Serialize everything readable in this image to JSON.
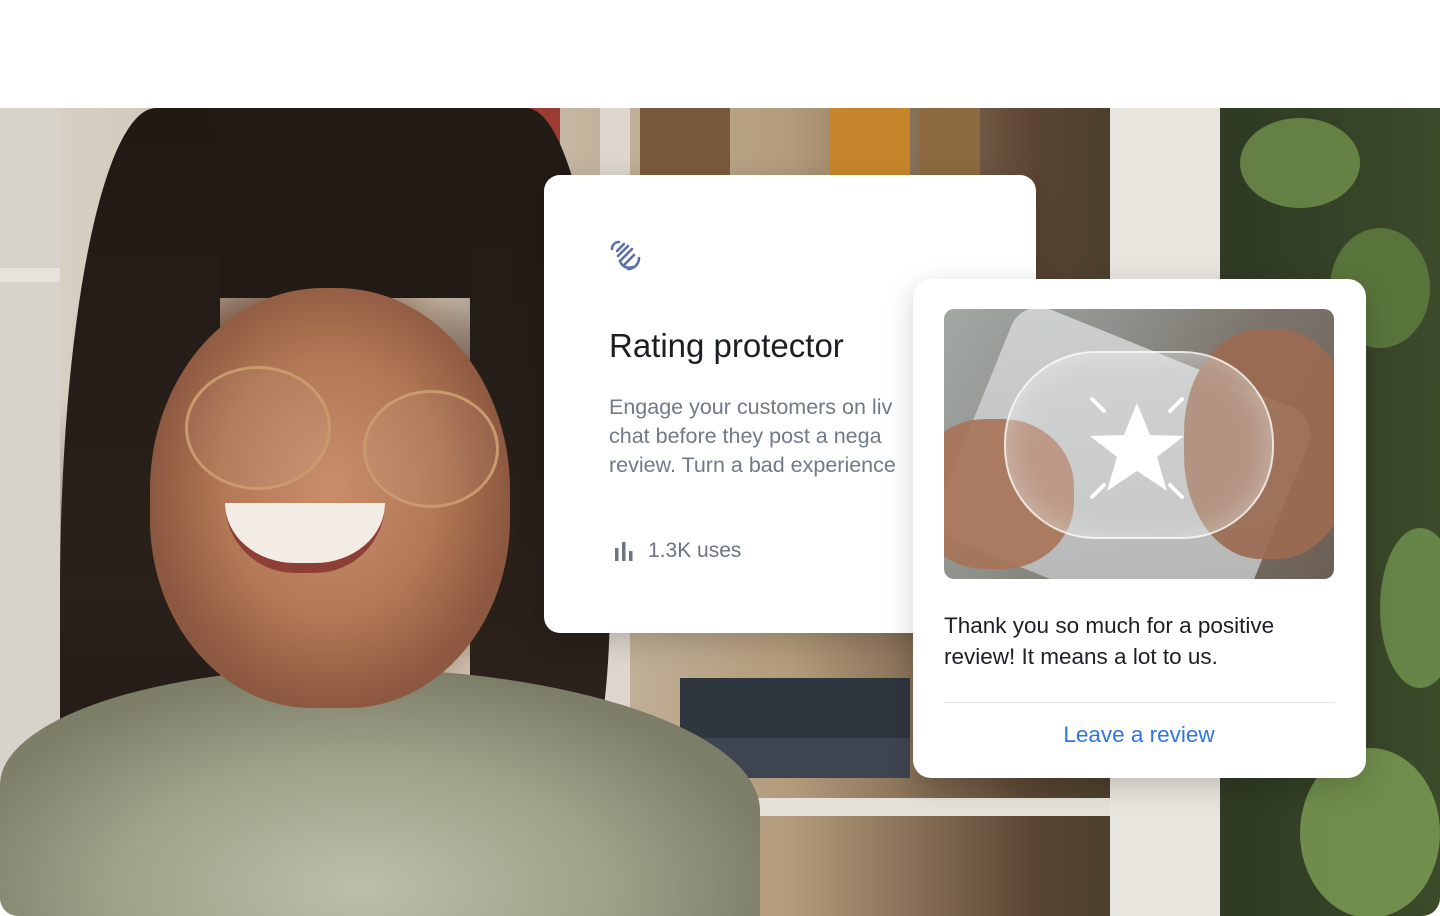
{
  "protector_card": {
    "icon": "waving-hand-icon",
    "title": "Rating protector",
    "description_lines": [
      "Engage your customers on liv",
      "chat before they post a nega",
      "review. Turn a bad experience"
    ],
    "uses_icon": "bar-chart-icon",
    "uses": "1.3K uses"
  },
  "review_card": {
    "image_icon": "star-icon",
    "message": "Thank you so much for a positive review! It means a lot to us.",
    "action_label": "Leave a review"
  },
  "colors": {
    "link": "#2f76e0",
    "title_text": "#1b1f24",
    "muted_text": "#707a88",
    "icon_blue": "#5b6fa8"
  }
}
